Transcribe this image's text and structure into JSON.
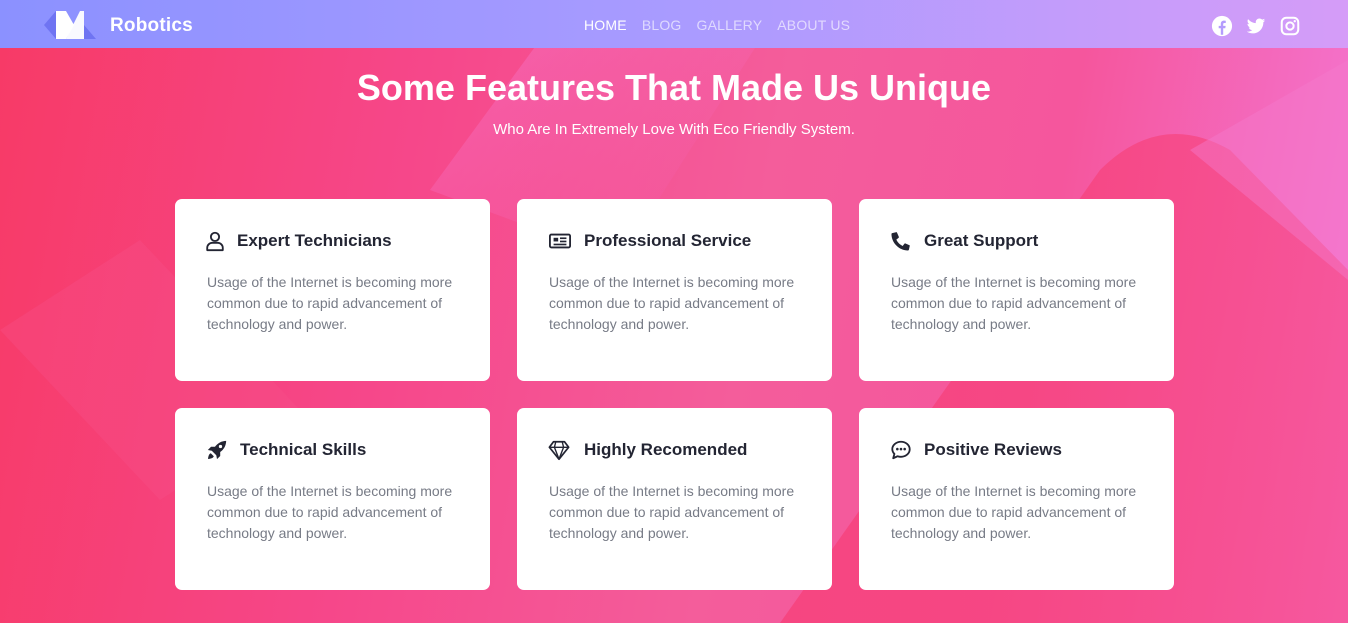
{
  "brand": {
    "name": "Robotics"
  },
  "nav": {
    "items": [
      {
        "label": "HOME",
        "active": true
      },
      {
        "label": "BLOG",
        "active": false
      },
      {
        "label": "GALLERY",
        "active": false
      },
      {
        "label": "ABOUT US",
        "active": false
      }
    ]
  },
  "social": [
    "facebook-icon",
    "twitter-icon",
    "instagram-icon"
  ],
  "hero": {
    "title": "Some Features That Made Us Unique",
    "subtitle": "Who Are In Extremely Love With Eco Friendly System."
  },
  "features": [
    {
      "icon": "user-icon",
      "title": "Expert Technicians",
      "text": "Usage of the Internet is becoming more common due to rapid advancement of technology and power."
    },
    {
      "icon": "newspaper-icon",
      "title": "Professional Service",
      "text": "Usage of the Internet is becoming more common due to rapid advancement of technology and power."
    },
    {
      "icon": "phone-icon",
      "title": "Great Support",
      "text": "Usage of the Internet is becoming more common due to rapid advancement of technology and power."
    },
    {
      "icon": "rocket-icon",
      "title": "Technical Skills",
      "text": "Usage of the Internet is becoming more common due to rapid advancement of technology and power."
    },
    {
      "icon": "diamond-icon",
      "title": "Highly Recomended",
      "text": "Usage of the Internet is becoming more common due to rapid advancement of technology and power."
    },
    {
      "icon": "chat-bubble-icon",
      "title": "Positive Reviews",
      "text": "Usage of the Internet is becoming more common due to rapid advancement of technology and power."
    }
  ],
  "colors": {
    "navbar_start": "#8b91ff",
    "navbar_end": "#d59cf8",
    "background_start": "#f73a66",
    "background_end": "#f47ad8",
    "card_title": "#232533",
    "card_text": "#777b86"
  }
}
